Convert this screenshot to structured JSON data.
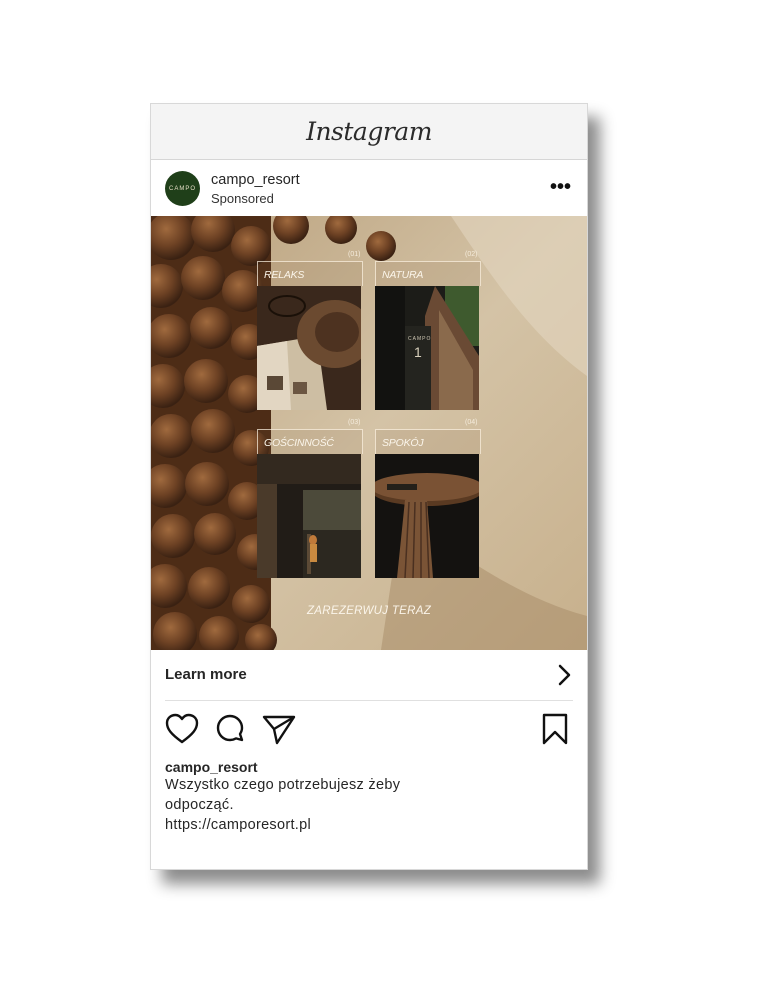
{
  "app": {
    "name": "Instagram"
  },
  "post": {
    "username": "campo_resort",
    "sponsored_label": "Sponsored",
    "avatar_text": "CAMPO",
    "more_label": "•••",
    "ad": {
      "tiles": [
        {
          "number": "(01)",
          "label": "RELAKS"
        },
        {
          "number": "(02)",
          "label": "NATURA"
        },
        {
          "number": "(03)",
          "label": "GOŚCINNOŚĆ"
        },
        {
          "number": "(04)",
          "label": "SPOKÓJ"
        }
      ],
      "cta": "ZAREZERWUJ TERAZ",
      "door_sign": "CAMPO",
      "door_number": "1"
    },
    "learn_more": "Learn more",
    "icons": [
      "heart-icon",
      "comment-icon",
      "send-icon",
      "bookmark-icon",
      "chevron-right-icon"
    ],
    "caption": {
      "username": "campo_resort",
      "lines": [
        "Wszystko czego potrzebujesz żeby",
        "odpocząć.",
        "https://camporesort.pl"
      ]
    }
  },
  "colors": {
    "avatar_bg": "#1f3f19",
    "header_bg": "#f4f4f4"
  }
}
